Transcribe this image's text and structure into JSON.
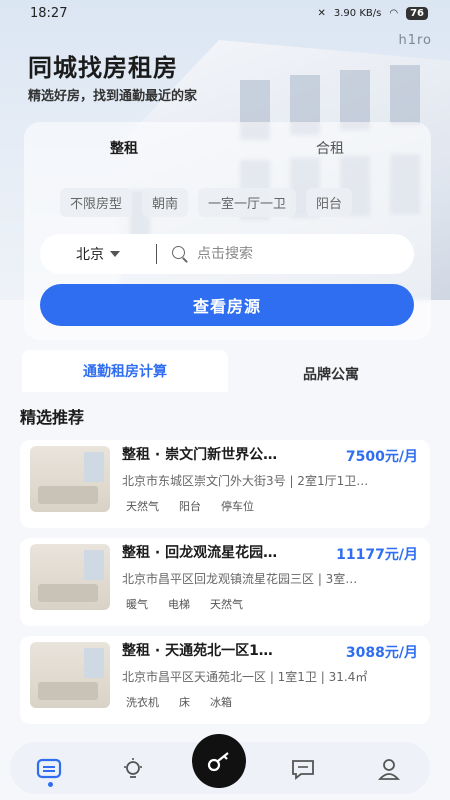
{
  "status": {
    "time": "18:27",
    "speed": "3.90 KB/s",
    "battery": "76"
  },
  "brand": "h1ro",
  "header": {
    "title": "同城找房租房",
    "subtitle": "精选好房，找到通勤最近的家"
  },
  "search_card": {
    "tabs": [
      "整租",
      "合租"
    ],
    "chips": [
      "不限房型",
      "朝南",
      "一室一厅一卫",
      "阳台"
    ],
    "city": "北京",
    "search_placeholder": "点击搜索",
    "view_button": "查看房源"
  },
  "section_tabs": [
    "通勤租房计算",
    "品牌公寓"
  ],
  "section_title": "精选推荐",
  "listings": [
    {
      "title": "整租 · 崇文门新世界公…",
      "price": "7500元/月",
      "address": "北京市东城区崇文门外大街3号 | 2室1厅1卫…",
      "tags": [
        "天然气",
        "阳台",
        "停车位"
      ]
    },
    {
      "title": "整租 · 回龙观流星花园…",
      "price": "11177元/月",
      "address": "北京市昌平区回龙观镇流星花园三区 | 3室…",
      "tags": [
        "暖气",
        "电梯",
        "天然气"
      ]
    },
    {
      "title": "整租 · 天通苑北一区1…",
      "price": "3088元/月",
      "address": "北京市昌平区天通苑北一区 | 1室1卫 | 31.4㎡",
      "tags": [
        "洗衣机",
        "床",
        "冰箱"
      ]
    }
  ],
  "nav": {
    "items": [
      "home-icon",
      "bulb-icon",
      "key-icon",
      "message-icon",
      "profile-icon"
    ],
    "active_color": "#2f6ef0"
  },
  "colors": {
    "accent": "#2f6ef0"
  }
}
